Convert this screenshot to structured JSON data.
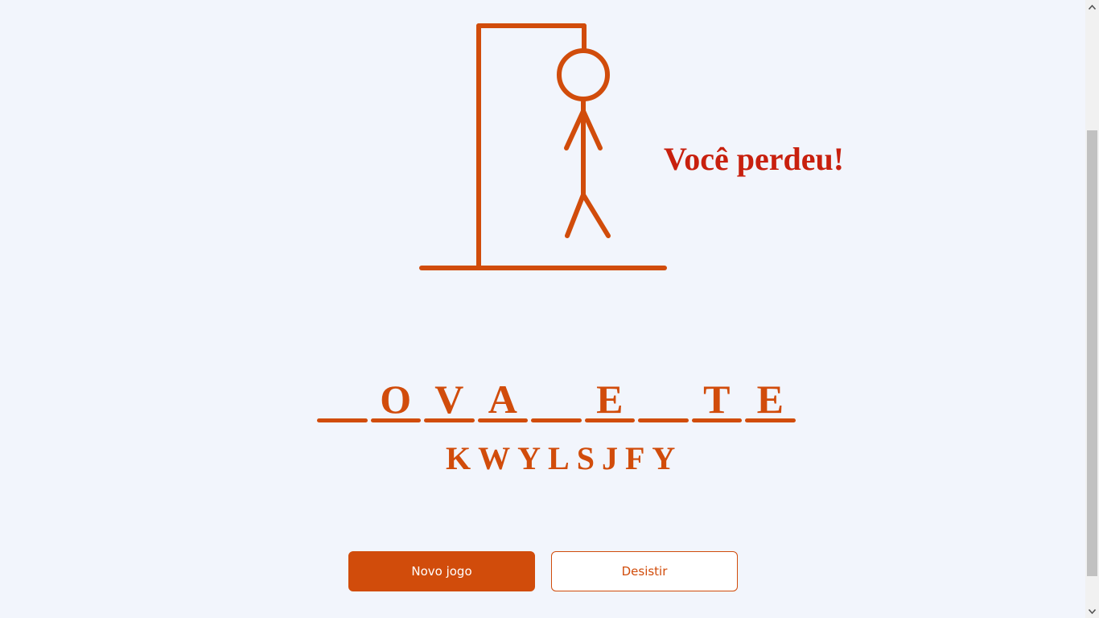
{
  "game": {
    "status": "Você perdeu!",
    "wrong_guesses_count": 6,
    "word_slots": [
      {
        "letter": ""
      },
      {
        "letter": "O"
      },
      {
        "letter": "V"
      },
      {
        "letter": "A"
      },
      {
        "letter": ""
      },
      {
        "letter": "E"
      },
      {
        "letter": ""
      },
      {
        "letter": "T"
      },
      {
        "letter": "E"
      }
    ],
    "wrong_letters": [
      "K",
      "W",
      "Y",
      "L",
      "S",
      "J",
      "F",
      "Y"
    ]
  },
  "buttons": {
    "new_game_label": "Novo jogo",
    "give_up_label": "Desistir"
  },
  "colors": {
    "accent": "#D14C0B",
    "status": "#C8200E",
    "background": "#F2F5FC"
  }
}
